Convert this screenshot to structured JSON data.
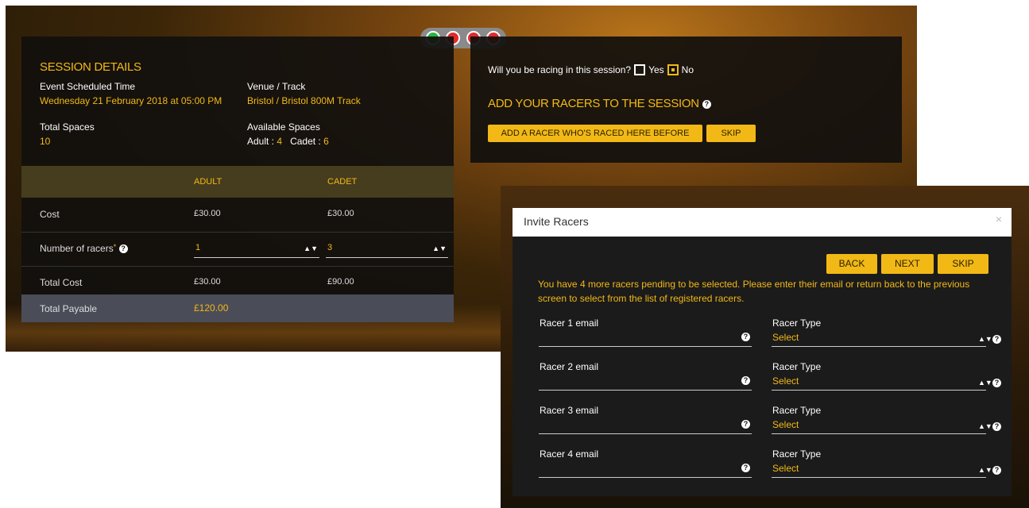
{
  "colors": {
    "accent": "#f2b916",
    "panel": "#121110",
    "modal_body": "#1b1b1b",
    "total_row": "#4a4c58"
  },
  "lights": [
    "green",
    "red",
    "red",
    "red"
  ],
  "session": {
    "title": "SESSION DETAILS",
    "time_label": "Event Scheduled Time",
    "time_value": "Wednesday 21 February 2018 at 05:00 PM",
    "venue_label": "Venue / Track",
    "venue_value": "Bristol / Bristol 800M Track",
    "total_spaces_label": "Total Spaces",
    "total_spaces_value": "10",
    "available_label": "Available Spaces",
    "adult_label": "Adult :",
    "adult_value": "4",
    "cadet_label": "Cadet :",
    "cadet_value": "6"
  },
  "table": {
    "headers": [
      "ADULT",
      "CADET"
    ],
    "cost_label": "Cost",
    "cost_adult": "£30.00",
    "cost_cadet": "£30.00",
    "num_label": "Number of racers",
    "num_adult": "1",
    "num_cadet": "3",
    "total_cost_label": "Total Cost",
    "total_cost_adult": "£30.00",
    "total_cost_cadet": "£90.00",
    "total_payable_label": "Total Payable",
    "total_payable_value": "£120.00"
  },
  "racing": {
    "question": "Will you be racing in this session?",
    "yes": "Yes",
    "no": "No",
    "selected": "No",
    "add_title": "ADD YOUR RACERS TO THE SESSION",
    "add_btn": "ADD A RACER WHO'S RACED HERE BEFORE",
    "skip_btn": "SKIP"
  },
  "modal": {
    "title": "Invite Racers",
    "close": "×",
    "back": "BACK",
    "next": "NEXT",
    "skip": "SKIP",
    "message": "You have 4 more racers pending to be selected. Please enter their email or return back to the previous screen to select from the list of registered racers.",
    "racers": [
      {
        "email_label": "Racer 1 email",
        "type_label": "Racer Type",
        "type_value": "Select"
      },
      {
        "email_label": "Racer 2 email",
        "type_label": "Racer Type",
        "type_value": "Select"
      },
      {
        "email_label": "Racer 3 email",
        "type_label": "Racer Type",
        "type_value": "Select"
      },
      {
        "email_label": "Racer 4 email",
        "type_label": "Racer Type",
        "type_value": "Select"
      }
    ]
  }
}
